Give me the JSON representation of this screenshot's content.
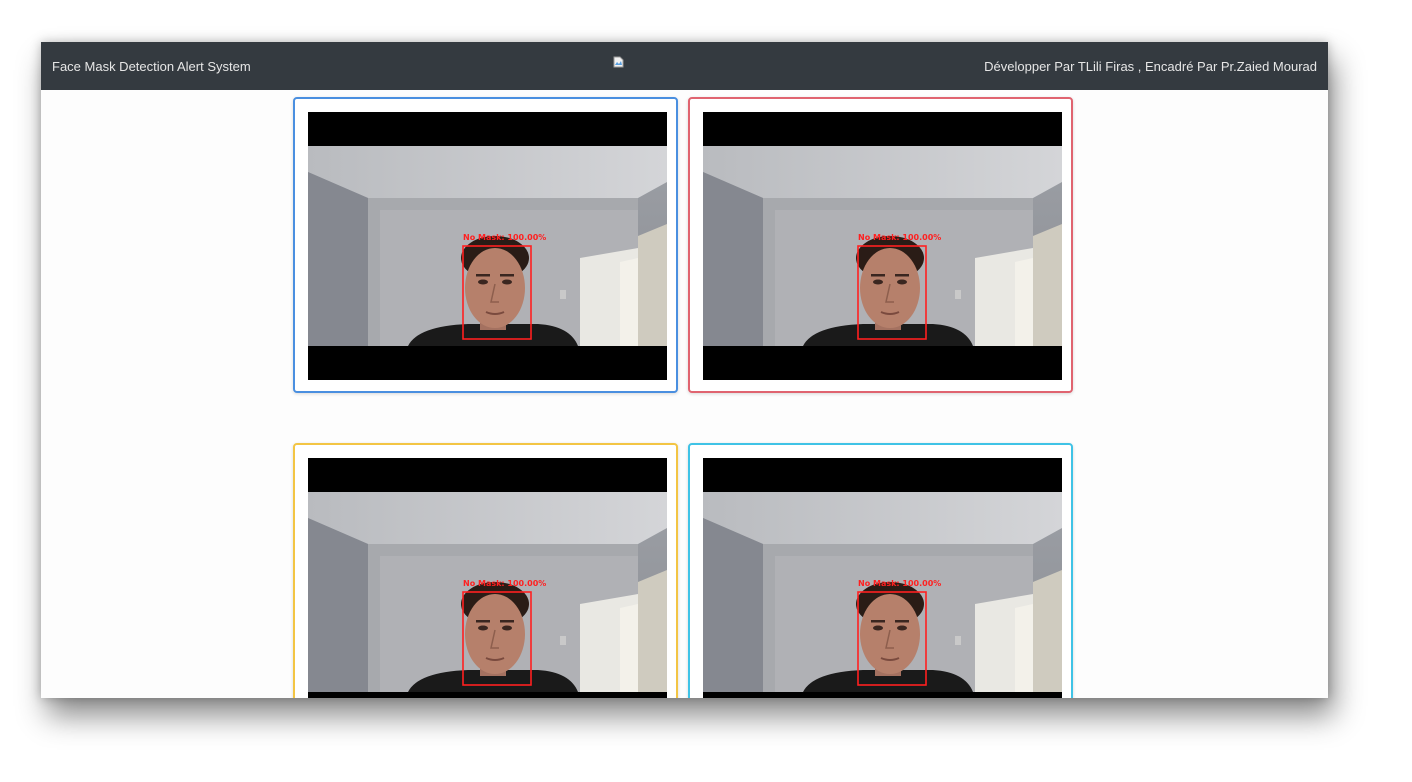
{
  "navbar": {
    "brand": "Face Mask Detection Alert System",
    "logo_alt": "broken-image-icon",
    "credits": "Développer Par TLili Firas , Encadré Par Pr.Zaied Mourad"
  },
  "cameras": [
    {
      "name": "camera-feed-1",
      "border_color": "#4a8fe0",
      "detection_label": "No Mask: 100.00%"
    },
    {
      "name": "camera-feed-2",
      "border_color": "#e06470",
      "detection_label": "No Mask: 100.00%"
    },
    {
      "name": "camera-feed-3",
      "border_color": "#f3c544",
      "detection_label": "No Mask: 100.00%"
    },
    {
      "name": "camera-feed-4",
      "border_color": "#3fc3e6",
      "detection_label": "No Mask: 100.00%"
    }
  ],
  "colors": {
    "navbar_bg": "#343a40",
    "detection_box": "#ff2020"
  }
}
